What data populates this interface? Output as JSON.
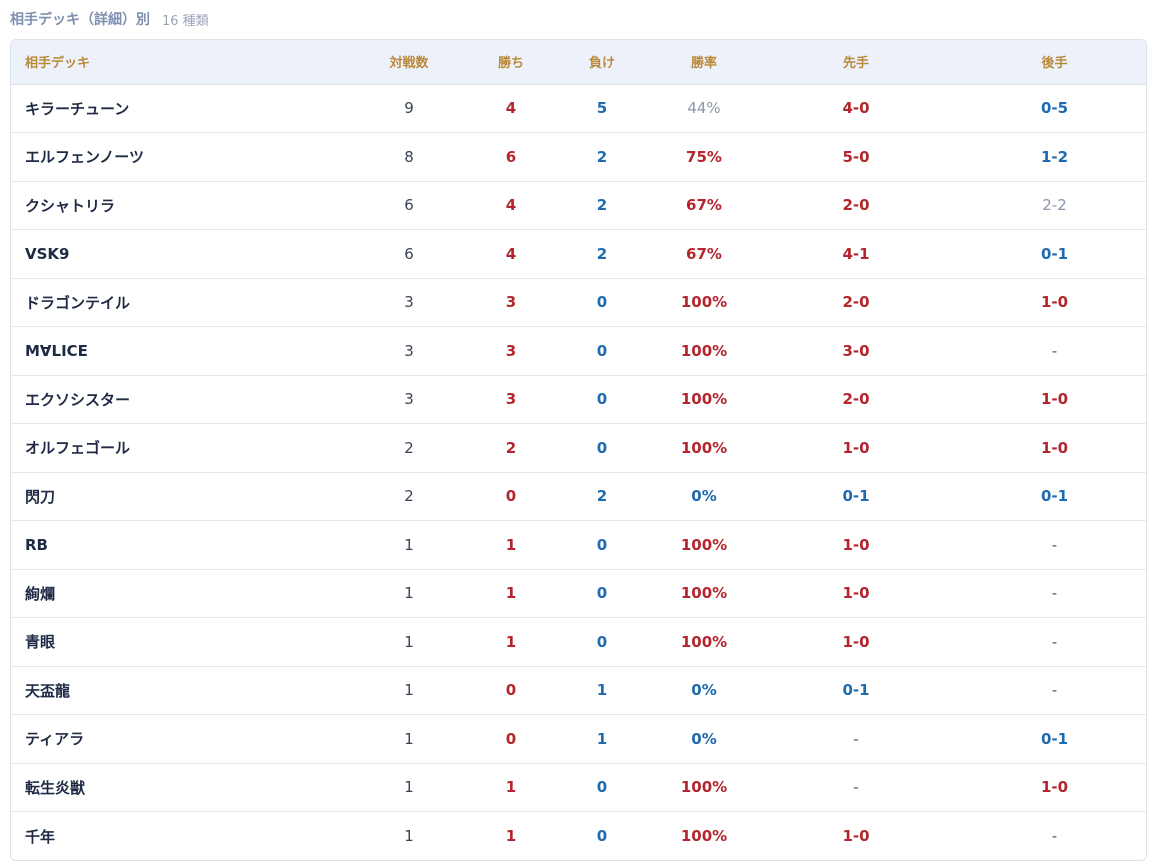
{
  "header": {
    "title": "相手デッキ（詳細）別",
    "count": "16 種類"
  },
  "columns": [
    "相手デッキ",
    "対戦数",
    "勝ち",
    "負け",
    "勝率",
    "先手",
    "後手"
  ],
  "colors": {
    "win": "#b3262e",
    "loss": "#1f6ab0",
    "neutral": "#8b97ac",
    "header_text": "#b98a3a",
    "header_bg": "#edf1fa"
  },
  "rows": [
    {
      "deck": "キラーチューン",
      "matches": "9",
      "wins": "4",
      "losses": "5",
      "rate": "44%",
      "first": "4-0",
      "second": "0-5"
    },
    {
      "deck": "エルフェンノーツ",
      "matches": "8",
      "wins": "6",
      "losses": "2",
      "rate": "75%",
      "first": "5-0",
      "second": "1-2"
    },
    {
      "deck": "クシャトリラ",
      "matches": "6",
      "wins": "4",
      "losses": "2",
      "rate": "67%",
      "first": "2-0",
      "second": "2-2"
    },
    {
      "deck": "VSK9",
      "matches": "6",
      "wins": "4",
      "losses": "2",
      "rate": "67%",
      "first": "4-1",
      "second": "0-1"
    },
    {
      "deck": "ドラゴンテイル",
      "matches": "3",
      "wins": "3",
      "losses": "0",
      "rate": "100%",
      "first": "2-0",
      "second": "1-0"
    },
    {
      "deck": "M∀LICE",
      "matches": "3",
      "wins": "3",
      "losses": "0",
      "rate": "100%",
      "first": "3-0",
      "second": "-"
    },
    {
      "deck": "エクソシスター",
      "matches": "3",
      "wins": "3",
      "losses": "0",
      "rate": "100%",
      "first": "2-0",
      "second": "1-0"
    },
    {
      "deck": "オルフェゴール",
      "matches": "2",
      "wins": "2",
      "losses": "0",
      "rate": "100%",
      "first": "1-0",
      "second": "1-0"
    },
    {
      "deck": "閃刀",
      "matches": "2",
      "wins": "0",
      "losses": "2",
      "rate": "0%",
      "first": "0-1",
      "second": "0-1"
    },
    {
      "deck": "RB",
      "matches": "1",
      "wins": "1",
      "losses": "0",
      "rate": "100%",
      "first": "1-0",
      "second": "-"
    },
    {
      "deck": "絢爛",
      "matches": "1",
      "wins": "1",
      "losses": "0",
      "rate": "100%",
      "first": "1-0",
      "second": "-"
    },
    {
      "deck": "青眼",
      "matches": "1",
      "wins": "1",
      "losses": "0",
      "rate": "100%",
      "first": "1-0",
      "second": "-"
    },
    {
      "deck": "天盃龍",
      "matches": "1",
      "wins": "0",
      "losses": "1",
      "rate": "0%",
      "first": "0-1",
      "second": "-"
    },
    {
      "deck": "ティアラ",
      "matches": "1",
      "wins": "0",
      "losses": "1",
      "rate": "0%",
      "first": "-",
      "second": "0-1"
    },
    {
      "deck": "転生炎獣",
      "matches": "1",
      "wins": "1",
      "losses": "0",
      "rate": "100%",
      "first": "-",
      "second": "1-0"
    },
    {
      "deck": "千年",
      "matches": "1",
      "wins": "1",
      "losses": "0",
      "rate": "100%",
      "first": "1-0",
      "second": "-"
    }
  ]
}
